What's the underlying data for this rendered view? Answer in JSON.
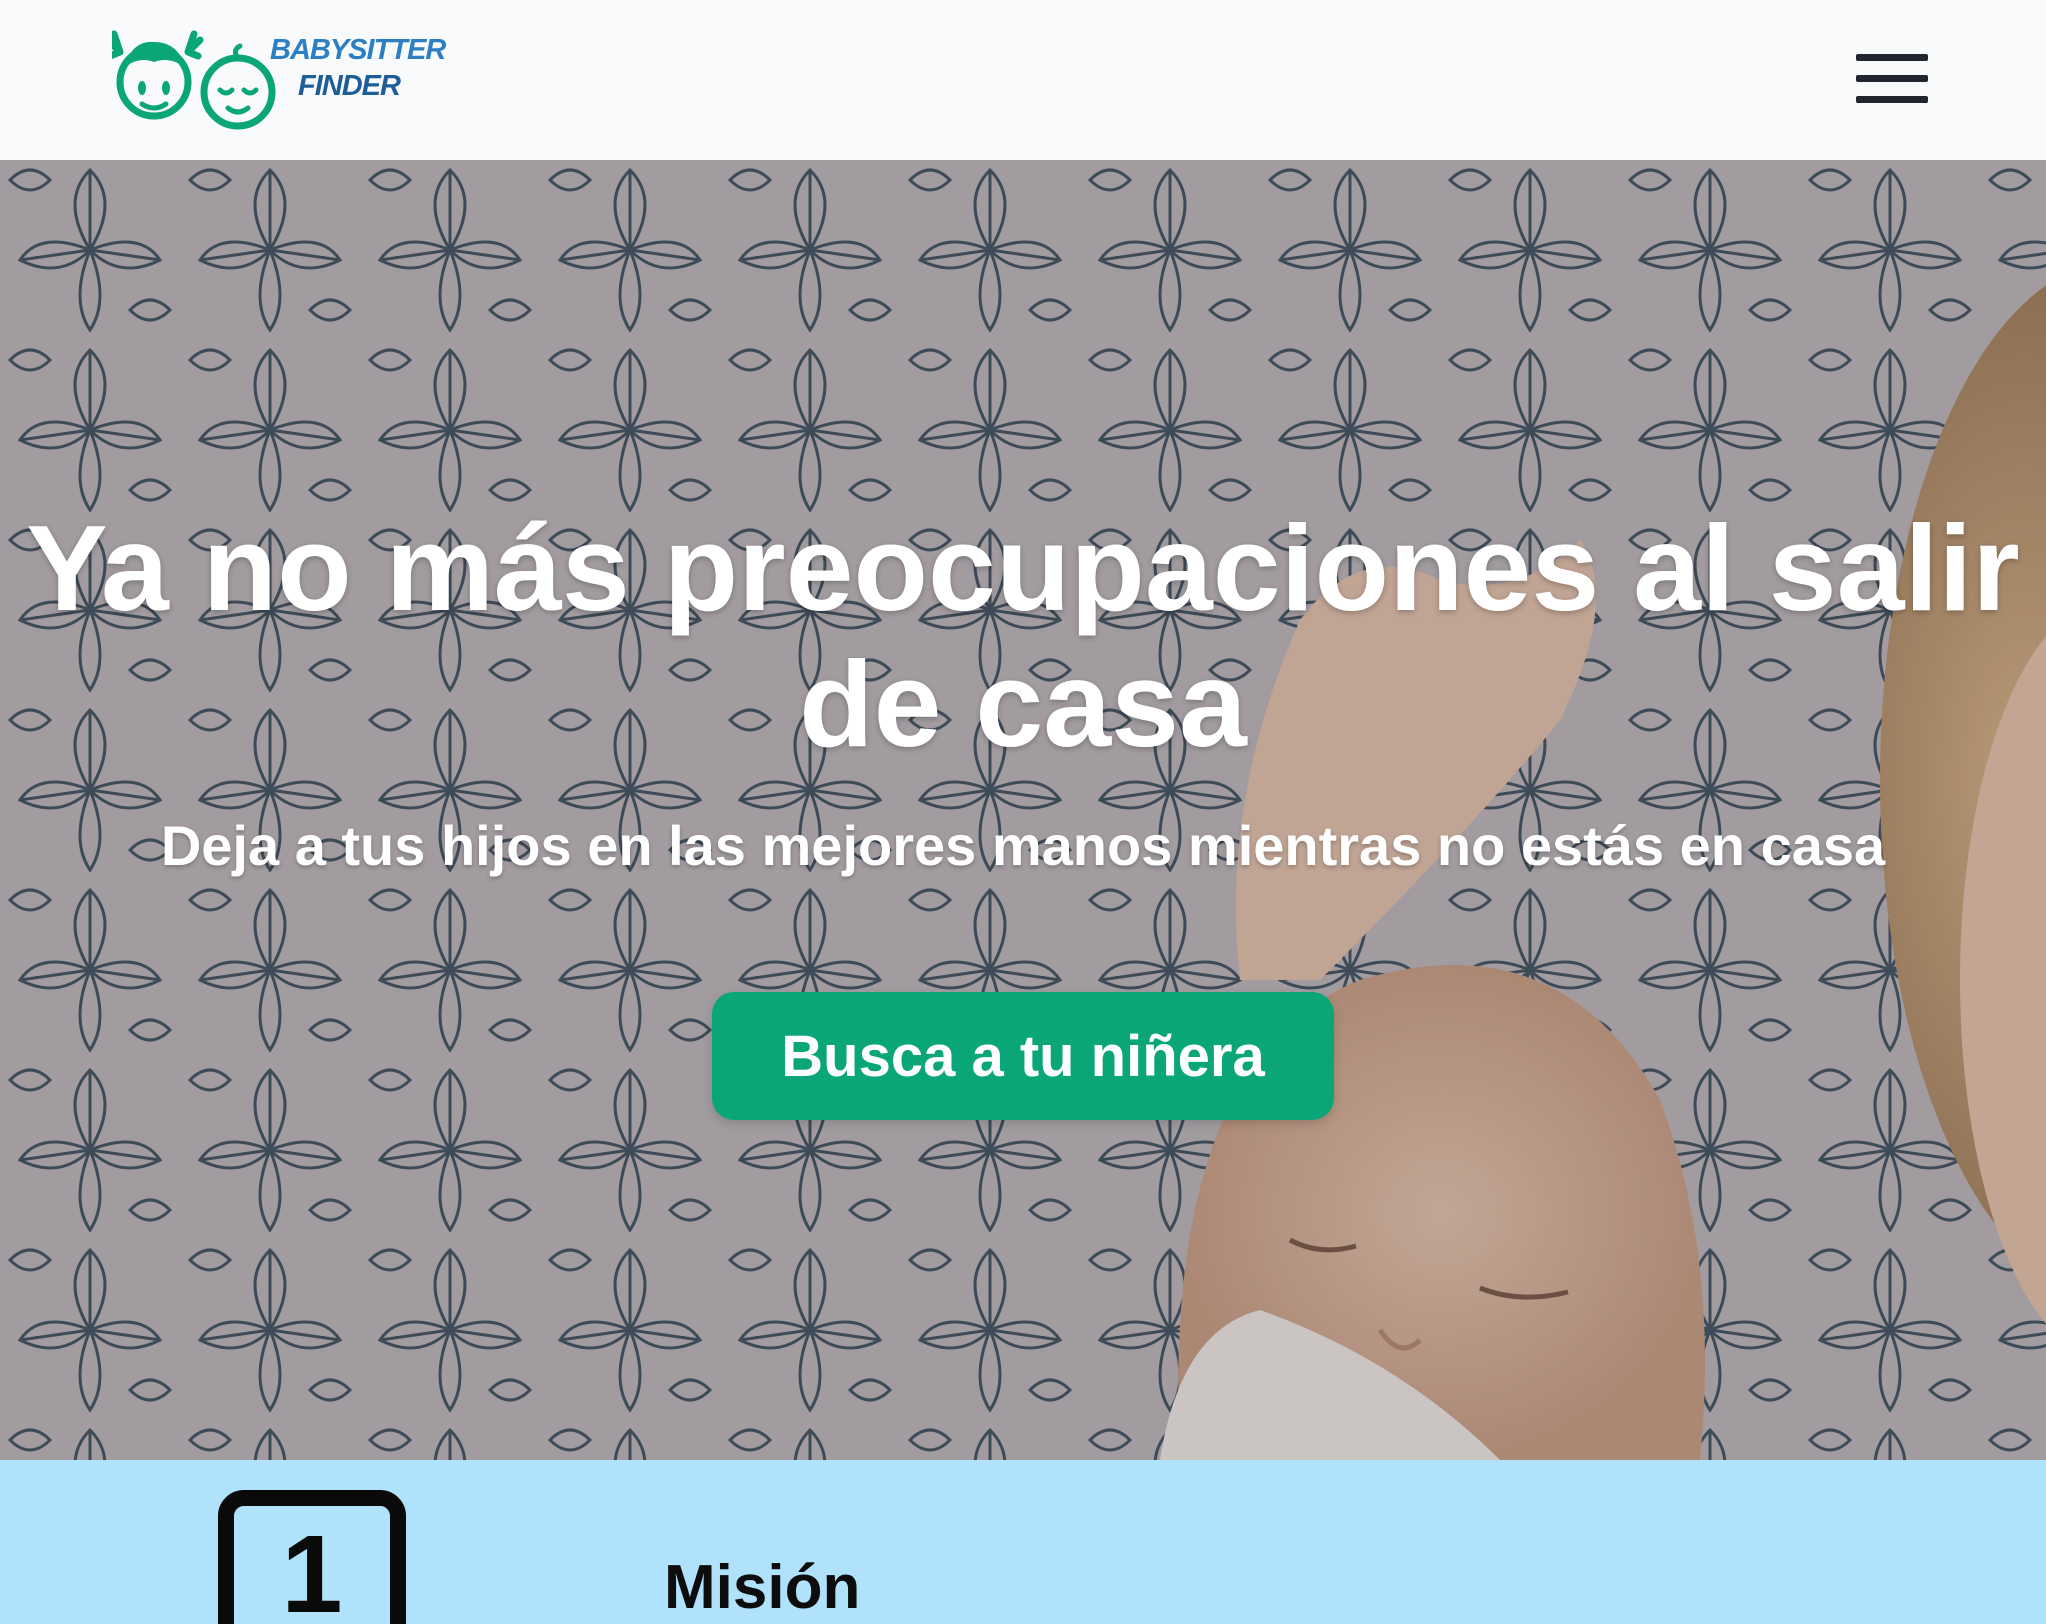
{
  "navbar": {
    "logo_line1": "BABYSITTER",
    "logo_line2": "FINDER",
    "menu_icon": "hamburger-icon"
  },
  "hero": {
    "title": "Ya no más preocupaciones al salir de casa",
    "subtitle": "Deja a tus hijos en las mejores manos mientras no estás en casa",
    "cta_label": "Busca a tu niñera"
  },
  "mission": {
    "step_number": "1",
    "title": "Misión"
  },
  "colors": {
    "brand_green": "#0aa678",
    "logo_blue": "#2d7fc4",
    "navbar_bg": "#f8fafc",
    "section_blue": "#b0e2fc"
  }
}
